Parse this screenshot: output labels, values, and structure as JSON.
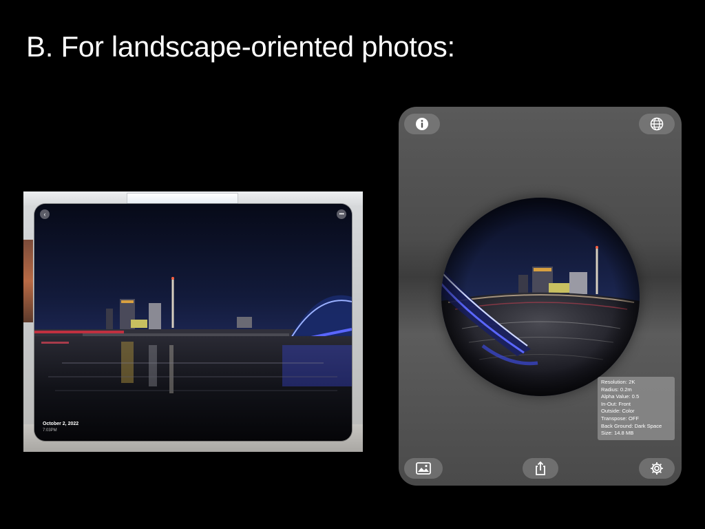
{
  "slide": {
    "title": "B. For landscape-oriented photos:"
  },
  "left_photo": {
    "date": "October 2, 2022",
    "time": "7:03PM",
    "back_icon": "chevron-left-icon",
    "more_icon": "ellipsis-icon"
  },
  "viewer": {
    "top_left_icon": "info-icon",
    "top_right_icon": "globe-icon",
    "bottom_left_icon": "photo-library-icon",
    "bottom_center_icon": "share-icon",
    "bottom_right_icon": "gear-icon",
    "info": {
      "resolution": "Resolution: 2K",
      "radius": "Radius: 0.2m",
      "alpha": "Alpha Value: 0.5",
      "in_out": "In-Out: Front",
      "outside": "Outside: Color",
      "transpose": "Transpose: OFF",
      "background": "Back Ground: Dark Space",
      "size": "Size:  14.8 MB"
    }
  },
  "colors": {
    "background": "#000000",
    "viewer_bg": "#4c4c4c",
    "button_bg": "#8c8c8c",
    "bridge_light": "#4a55ff"
  }
}
